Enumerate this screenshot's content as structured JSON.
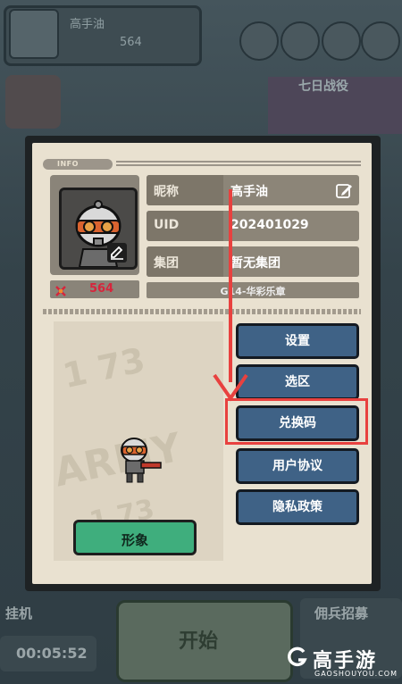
{
  "background": {
    "player_name": "高手油",
    "player_score": "564",
    "event_banner": "七日战役",
    "idle_label": "挂机",
    "idle_timer": "00:05:52",
    "start_label": "开始",
    "recruit_label": "佣兵招募"
  },
  "panel": {
    "section_label": "INFO",
    "nickname_label": "昵称",
    "nickname_value": "高手油",
    "uid_label": "UID",
    "uid_value": "202401029",
    "guild_label": "集团",
    "guild_value": "暂无集团",
    "server_value": "G14-华彩乐章",
    "power_value": "564",
    "appearance_button": "形象",
    "menu": [
      {
        "label": "设置"
      },
      {
        "label": "选区"
      },
      {
        "label": "兑换码"
      },
      {
        "label": "用户协议"
      },
      {
        "label": "隐私政策"
      }
    ]
  },
  "overlay": {
    "highlight_color": "#e8413f",
    "highlight_target": "兑换码"
  },
  "watermark": {
    "logo_icon": "G-logo-icon",
    "title": "高手游",
    "subtitle": "GAOSHOUYOU.COM"
  }
}
